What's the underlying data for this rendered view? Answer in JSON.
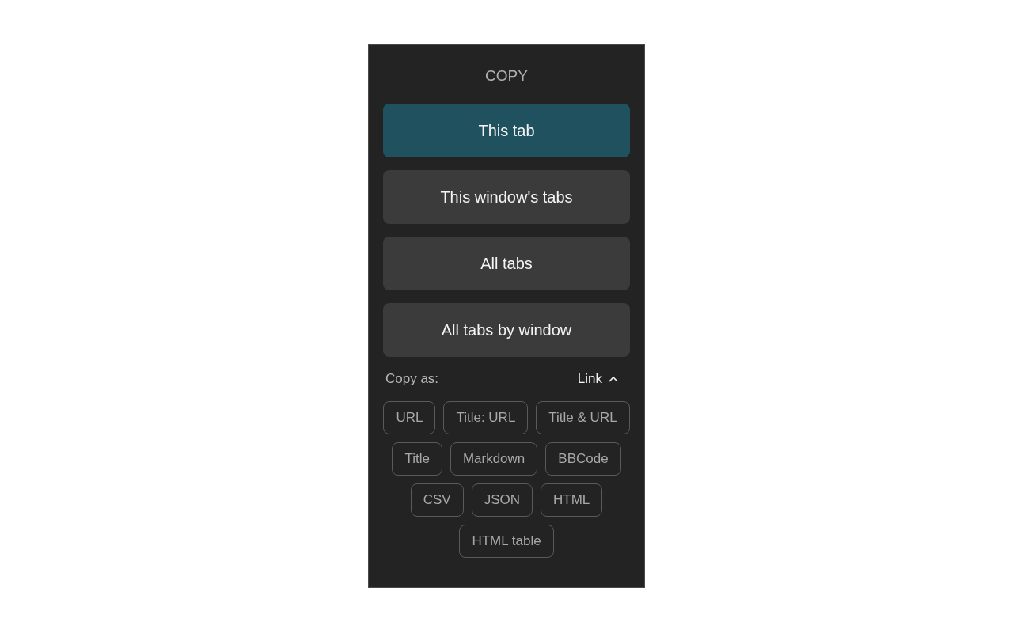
{
  "title": "COPY",
  "scopes": [
    {
      "label": "This tab",
      "selected": true
    },
    {
      "label": "This window's tabs",
      "selected": false
    },
    {
      "label": "All tabs",
      "selected": false
    },
    {
      "label": "All tabs by window",
      "selected": false
    }
  ],
  "copy_as": {
    "label": "Copy as:",
    "value": "Link",
    "expanded": true
  },
  "formats": [
    "URL",
    "Title: URL",
    "Title & URL",
    "Title",
    "Markdown",
    "BBCode",
    "CSV",
    "JSON",
    "HTML",
    "HTML table"
  ]
}
